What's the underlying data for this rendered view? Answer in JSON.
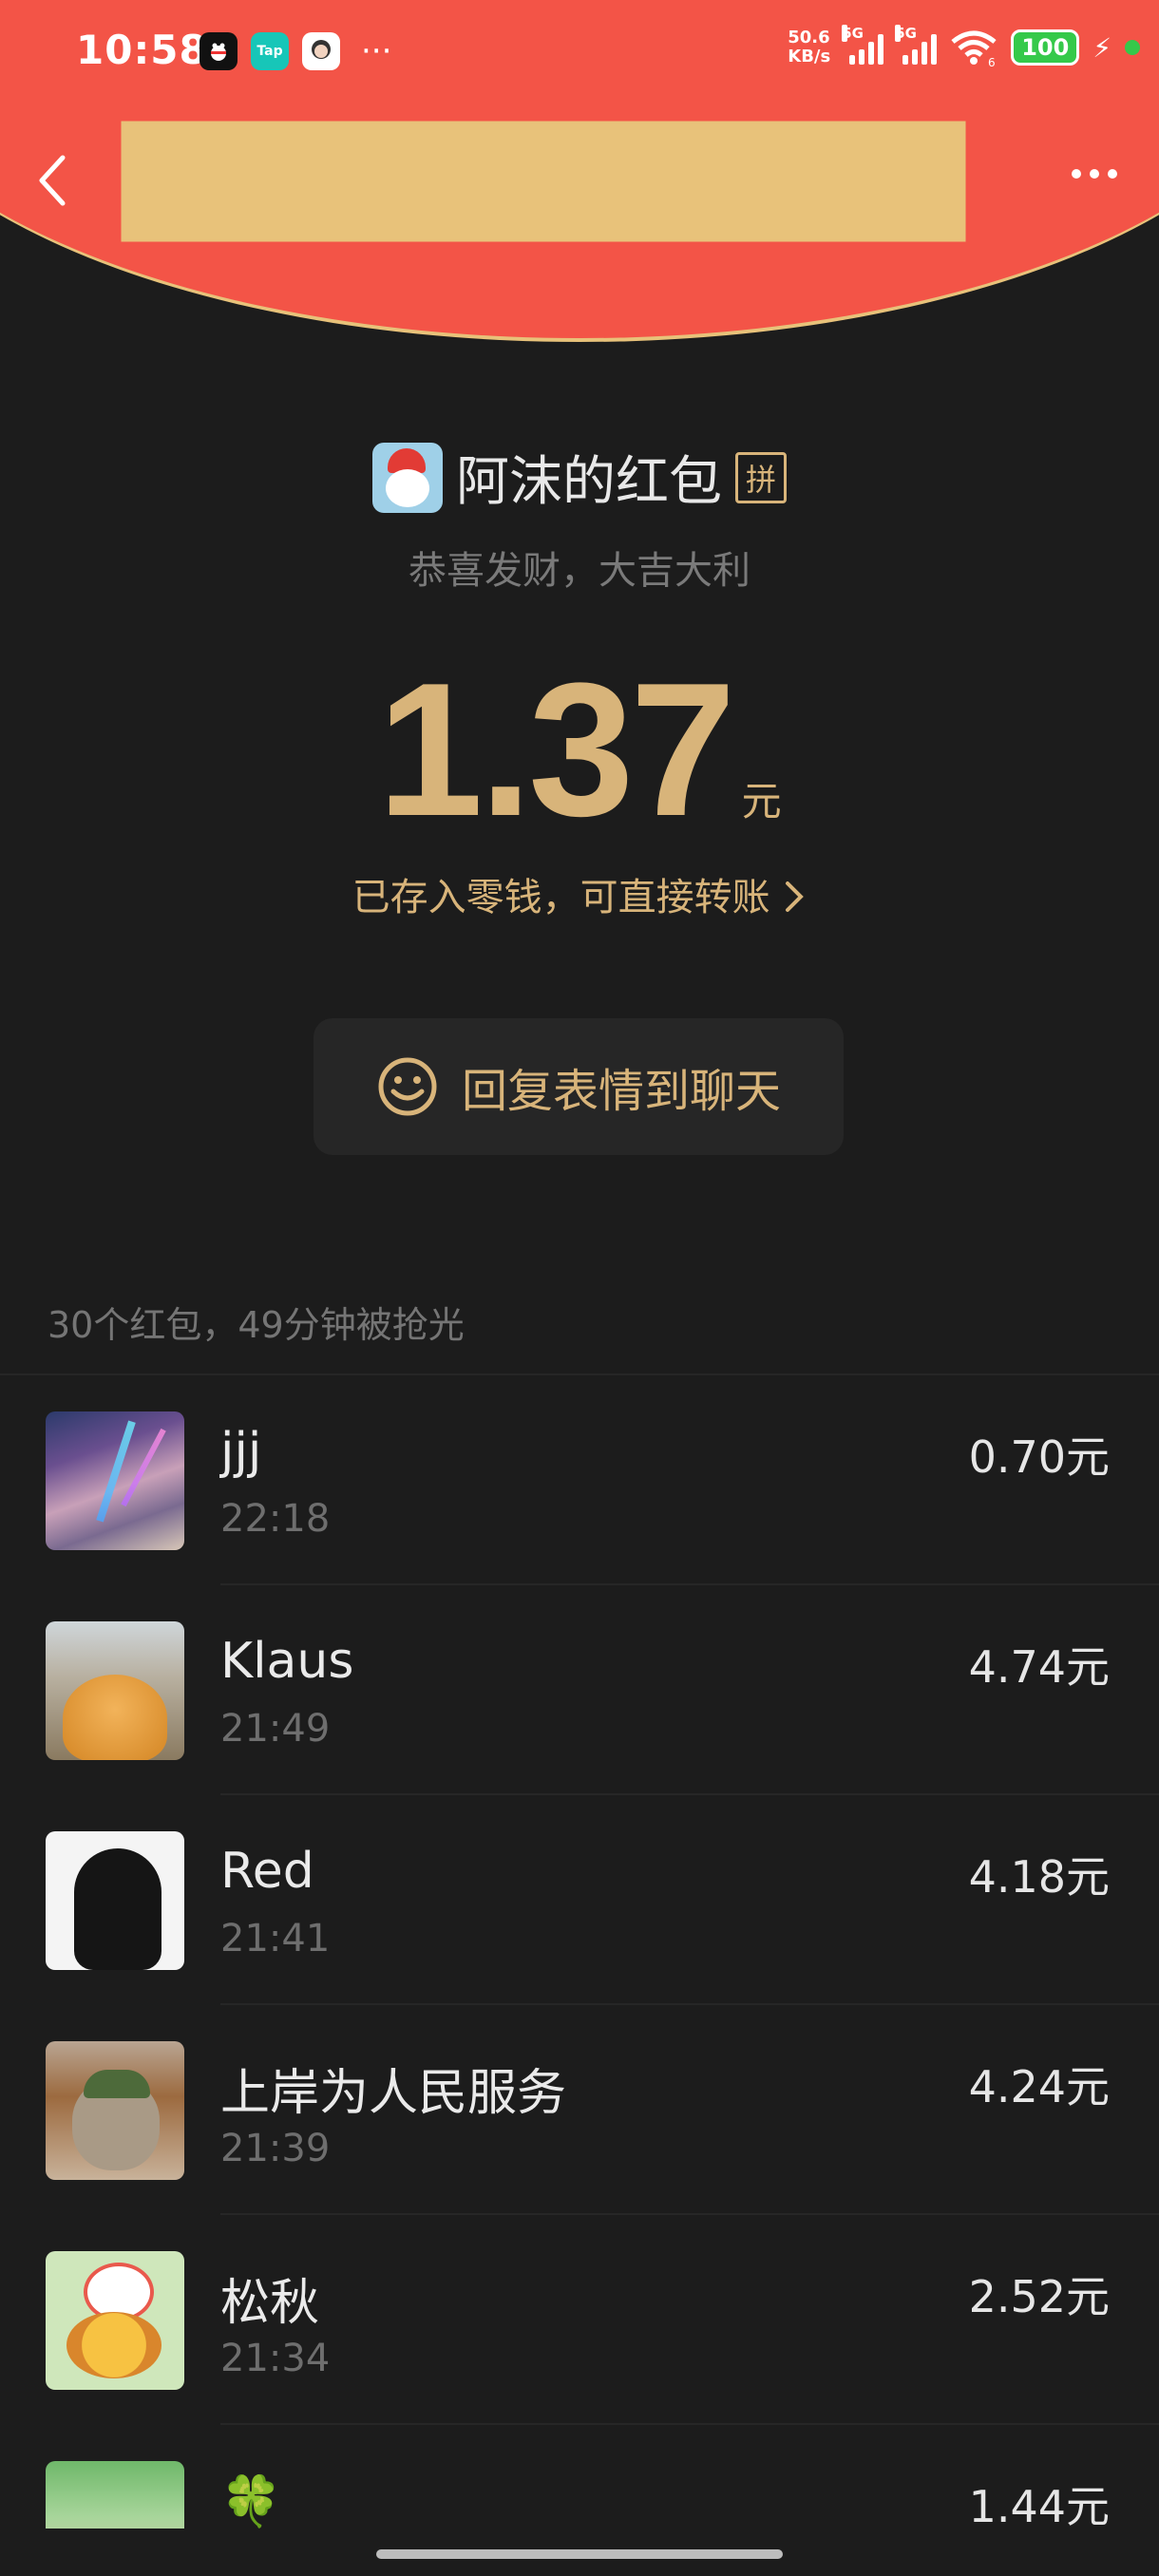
{
  "status_bar": {
    "time": "10:58",
    "more": "···",
    "net_speed_top": "50.6",
    "net_speed_bottom": "KB/s",
    "signal_1": "5G",
    "signal_2": "5G",
    "wifi_label": "6",
    "battery": "100",
    "app_icons": [
      "qq-icon",
      "tap-icon",
      "face-avatar-icon"
    ]
  },
  "nav": {
    "back_icon": "chevron-left-icon",
    "more_icon": "more-dots-icon"
  },
  "colors": {
    "header_red": "#f35447",
    "gold": "#d8b47a",
    "background": "#1c1c1c"
  },
  "envelope": {
    "sender_name": "阿沫的红包",
    "badge": "拼",
    "greeting": "恭喜发财，大吉大利",
    "amount": "1.37",
    "unit": "元",
    "saved_text": "已存入零钱，可直接转账",
    "reply_button": "回复表情到聊天"
  },
  "summary": "30个红包，49分钟被抢光",
  "recipients": [
    {
      "name": "jjj",
      "time": "22:18",
      "amount": "0.70元"
    },
    {
      "name": "Klaus",
      "time": "21:49",
      "amount": "4.74元"
    },
    {
      "name": "Red",
      "time": "21:41",
      "amount": "4.18元"
    },
    {
      "name": "上岸为人民服务",
      "time": "21:39",
      "amount": "4.24元"
    },
    {
      "name": "松秋",
      "time": "21:34",
      "amount": "2.52元"
    },
    {
      "name": "🍀",
      "time": "",
      "amount": "1.44元"
    }
  ]
}
